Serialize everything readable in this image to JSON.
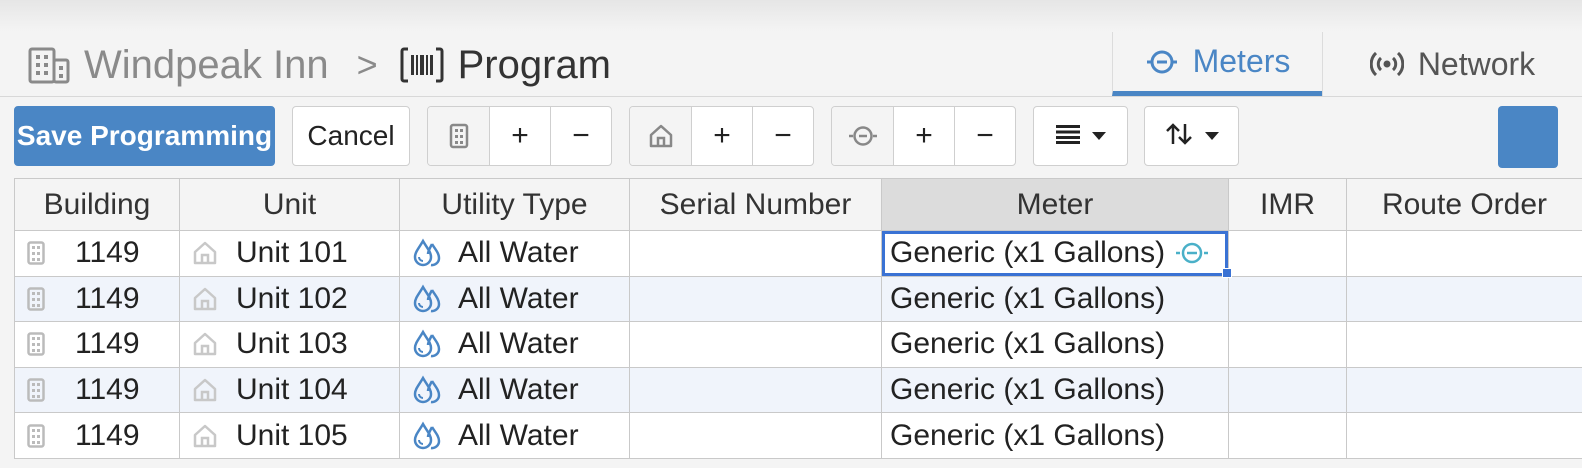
{
  "breadcrumb": {
    "building_icon": "building-icon",
    "building": "Windpeak Inn",
    "separator": ">",
    "page_icon": "barcode-icon",
    "page": "Program"
  },
  "tabs": [
    {
      "label": "Meters",
      "icon": "meter-icon",
      "active": true
    },
    {
      "label": "Network",
      "icon": "broadcast-icon",
      "active": false
    }
  ],
  "toolbar": {
    "save_label": "Save Programming",
    "cancel_label": "Cancel",
    "plus": "+",
    "minus": "−",
    "groups": [
      "building",
      "unit",
      "meter"
    ],
    "view_menu_icon": "list-icon",
    "sort_menu_icon": "sort-icon"
  },
  "table": {
    "columns": [
      "Building",
      "Unit",
      "Utility Type",
      "Serial Number",
      "Meter",
      "IMR",
      "Route Order"
    ],
    "selected_column": "Meter",
    "rows": [
      {
        "building": "1149",
        "unit": "Unit 101",
        "utility": "All Water",
        "serial": "",
        "meter": "Generic (x1 Gallons)",
        "imr": "",
        "route": ""
      },
      {
        "building": "1149",
        "unit": "Unit 102",
        "utility": "All Water",
        "serial": "",
        "meter": "Generic (x1 Gallons)",
        "imr": "",
        "route": ""
      },
      {
        "building": "1149",
        "unit": "Unit 103",
        "utility": "All Water",
        "serial": "",
        "meter": "Generic (x1 Gallons)",
        "imr": "",
        "route": ""
      },
      {
        "building": "1149",
        "unit": "Unit 104",
        "utility": "All Water",
        "serial": "",
        "meter": "Generic (x1 Gallons)",
        "imr": "",
        "route": ""
      },
      {
        "building": "1149",
        "unit": "Unit 105",
        "utility": "All Water",
        "serial": "",
        "meter": "Generic (x1 Gallons)",
        "imr": "",
        "route": ""
      }
    ]
  },
  "colors": {
    "accent": "#4a86c5",
    "focus": "#3a72d4",
    "row_alt": "#f0f4fb"
  }
}
